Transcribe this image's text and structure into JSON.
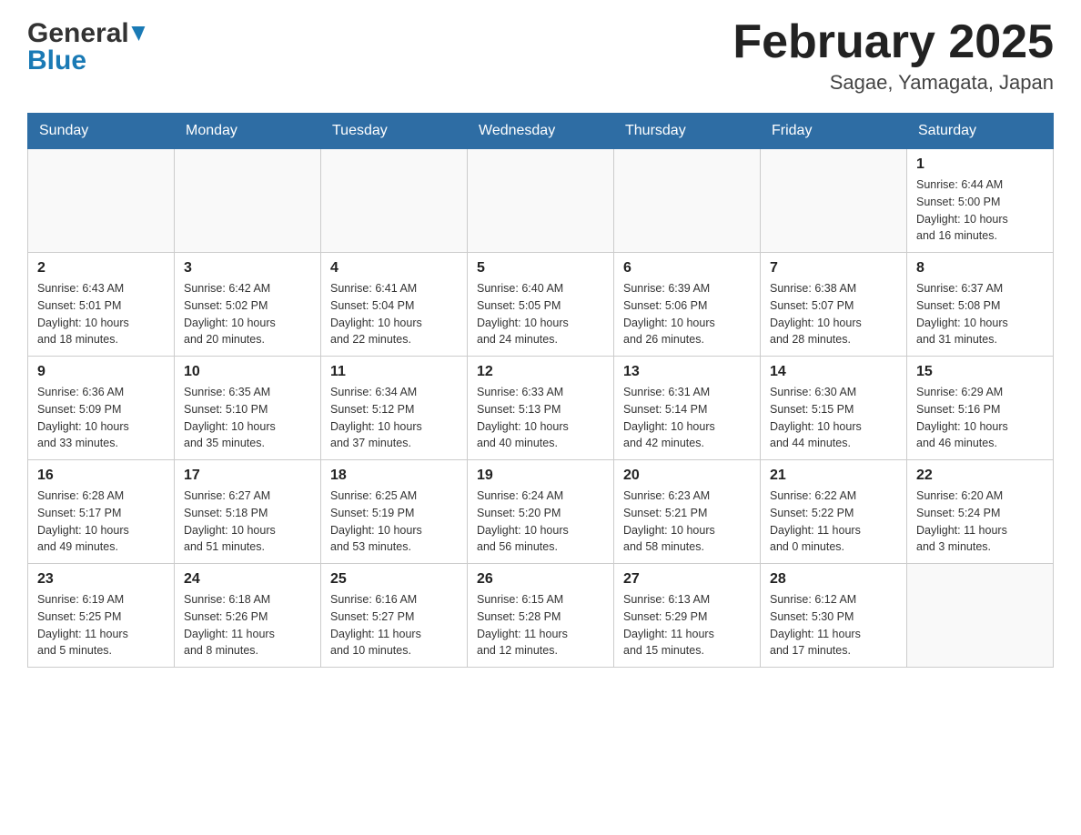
{
  "header": {
    "logo_general": "General",
    "logo_blue": "Blue",
    "month_title": "February 2025",
    "location": "Sagae, Yamagata, Japan"
  },
  "weekdays": [
    "Sunday",
    "Monday",
    "Tuesday",
    "Wednesday",
    "Thursday",
    "Friday",
    "Saturday"
  ],
  "weeks": [
    [
      {
        "day": "",
        "info": ""
      },
      {
        "day": "",
        "info": ""
      },
      {
        "day": "",
        "info": ""
      },
      {
        "day": "",
        "info": ""
      },
      {
        "day": "",
        "info": ""
      },
      {
        "day": "",
        "info": ""
      },
      {
        "day": "1",
        "info": "Sunrise: 6:44 AM\nSunset: 5:00 PM\nDaylight: 10 hours\nand 16 minutes."
      }
    ],
    [
      {
        "day": "2",
        "info": "Sunrise: 6:43 AM\nSunset: 5:01 PM\nDaylight: 10 hours\nand 18 minutes."
      },
      {
        "day": "3",
        "info": "Sunrise: 6:42 AM\nSunset: 5:02 PM\nDaylight: 10 hours\nand 20 minutes."
      },
      {
        "day": "4",
        "info": "Sunrise: 6:41 AM\nSunset: 5:04 PM\nDaylight: 10 hours\nand 22 minutes."
      },
      {
        "day": "5",
        "info": "Sunrise: 6:40 AM\nSunset: 5:05 PM\nDaylight: 10 hours\nand 24 minutes."
      },
      {
        "day": "6",
        "info": "Sunrise: 6:39 AM\nSunset: 5:06 PM\nDaylight: 10 hours\nand 26 minutes."
      },
      {
        "day": "7",
        "info": "Sunrise: 6:38 AM\nSunset: 5:07 PM\nDaylight: 10 hours\nand 28 minutes."
      },
      {
        "day": "8",
        "info": "Sunrise: 6:37 AM\nSunset: 5:08 PM\nDaylight: 10 hours\nand 31 minutes."
      }
    ],
    [
      {
        "day": "9",
        "info": "Sunrise: 6:36 AM\nSunset: 5:09 PM\nDaylight: 10 hours\nand 33 minutes."
      },
      {
        "day": "10",
        "info": "Sunrise: 6:35 AM\nSunset: 5:10 PM\nDaylight: 10 hours\nand 35 minutes."
      },
      {
        "day": "11",
        "info": "Sunrise: 6:34 AM\nSunset: 5:12 PM\nDaylight: 10 hours\nand 37 minutes."
      },
      {
        "day": "12",
        "info": "Sunrise: 6:33 AM\nSunset: 5:13 PM\nDaylight: 10 hours\nand 40 minutes."
      },
      {
        "day": "13",
        "info": "Sunrise: 6:31 AM\nSunset: 5:14 PM\nDaylight: 10 hours\nand 42 minutes."
      },
      {
        "day": "14",
        "info": "Sunrise: 6:30 AM\nSunset: 5:15 PM\nDaylight: 10 hours\nand 44 minutes."
      },
      {
        "day": "15",
        "info": "Sunrise: 6:29 AM\nSunset: 5:16 PM\nDaylight: 10 hours\nand 46 minutes."
      }
    ],
    [
      {
        "day": "16",
        "info": "Sunrise: 6:28 AM\nSunset: 5:17 PM\nDaylight: 10 hours\nand 49 minutes."
      },
      {
        "day": "17",
        "info": "Sunrise: 6:27 AM\nSunset: 5:18 PM\nDaylight: 10 hours\nand 51 minutes."
      },
      {
        "day": "18",
        "info": "Sunrise: 6:25 AM\nSunset: 5:19 PM\nDaylight: 10 hours\nand 53 minutes."
      },
      {
        "day": "19",
        "info": "Sunrise: 6:24 AM\nSunset: 5:20 PM\nDaylight: 10 hours\nand 56 minutes."
      },
      {
        "day": "20",
        "info": "Sunrise: 6:23 AM\nSunset: 5:21 PM\nDaylight: 10 hours\nand 58 minutes."
      },
      {
        "day": "21",
        "info": "Sunrise: 6:22 AM\nSunset: 5:22 PM\nDaylight: 11 hours\nand 0 minutes."
      },
      {
        "day": "22",
        "info": "Sunrise: 6:20 AM\nSunset: 5:24 PM\nDaylight: 11 hours\nand 3 minutes."
      }
    ],
    [
      {
        "day": "23",
        "info": "Sunrise: 6:19 AM\nSunset: 5:25 PM\nDaylight: 11 hours\nand 5 minutes."
      },
      {
        "day": "24",
        "info": "Sunrise: 6:18 AM\nSunset: 5:26 PM\nDaylight: 11 hours\nand 8 minutes."
      },
      {
        "day": "25",
        "info": "Sunrise: 6:16 AM\nSunset: 5:27 PM\nDaylight: 11 hours\nand 10 minutes."
      },
      {
        "day": "26",
        "info": "Sunrise: 6:15 AM\nSunset: 5:28 PM\nDaylight: 11 hours\nand 12 minutes."
      },
      {
        "day": "27",
        "info": "Sunrise: 6:13 AM\nSunset: 5:29 PM\nDaylight: 11 hours\nand 15 minutes."
      },
      {
        "day": "28",
        "info": "Sunrise: 6:12 AM\nSunset: 5:30 PM\nDaylight: 11 hours\nand 17 minutes."
      },
      {
        "day": "",
        "info": ""
      }
    ]
  ]
}
